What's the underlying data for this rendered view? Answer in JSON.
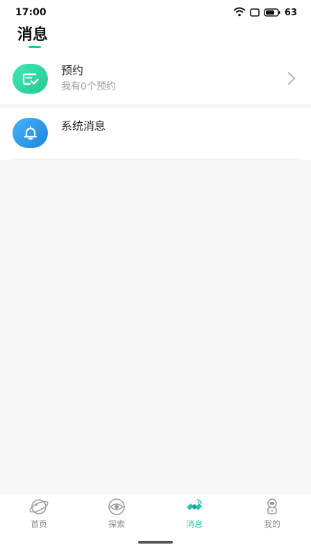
{
  "status_bar": {
    "time": "17:00",
    "battery": "63",
    "icons": [
      "wifi-icon",
      "sim-icon",
      "battery-icon"
    ]
  },
  "header": {
    "title": "消息"
  },
  "messages": [
    {
      "title": "预约",
      "subtitle": "我有0个预约",
      "icon": "appointment-icon",
      "color": "#2bd29f"
    },
    {
      "title": "系统消息",
      "icon": "bell-icon",
      "color": "#2a96e8"
    }
  ],
  "tabs": [
    {
      "label": "首页",
      "icon": "planet-icon"
    },
    {
      "label": "探索",
      "icon": "eye-icon"
    },
    {
      "label": "消息",
      "icon": "satellite-icon",
      "active": true
    },
    {
      "label": "我的",
      "icon": "astronaut-icon"
    }
  ],
  "colors": {
    "accent": "#26c5b3",
    "inactive": "#8c8c8c"
  }
}
